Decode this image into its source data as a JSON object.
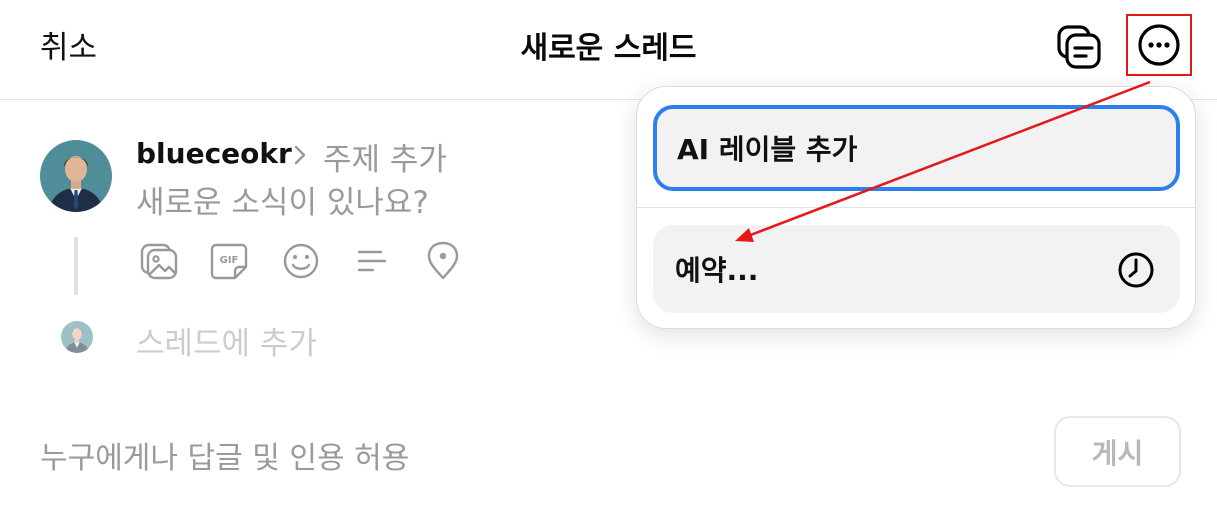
{
  "header": {
    "cancel_label": "취소",
    "title": "새로운 스레드"
  },
  "composer": {
    "username": "blueceokr",
    "topic_placeholder": "주제 추가",
    "body_placeholder": "새로운 소식이 있나요?",
    "tools": [
      "gallery-icon",
      "gif-icon",
      "emoji-icon",
      "poll-icon",
      "location-icon"
    ],
    "add_thread_label": "스레드에 추가"
  },
  "footer": {
    "reply_setting": "누구에게나 답글 및 인용 허용",
    "post_label": "게시"
  },
  "menu": {
    "ai_label": "AI 레이블 추가",
    "schedule_label": "예약..."
  },
  "colors": {
    "focus_ring": "#2d7ff0",
    "annotation": "#e31919",
    "placeholder": "#9a9a9a"
  }
}
